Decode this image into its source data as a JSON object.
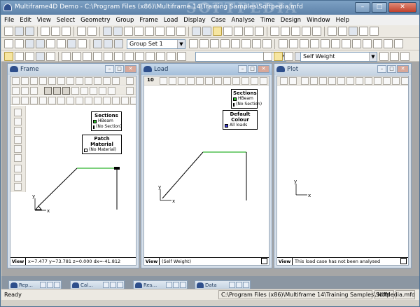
{
  "window": {
    "title": "Multiframe4D Demo - C:\\Program Files (x86)\\Multiframe 14\\Training Samples\\Softpedia.mfd",
    "watermark": "SOFTPEDIA",
    "min_label": "–",
    "max_label": "□",
    "close_label": "✕"
  },
  "menu": [
    "File",
    "Edit",
    "View",
    "Select",
    "Geometry",
    "Group",
    "Frame",
    "Load",
    "Display",
    "Case",
    "Analyse",
    "Time",
    "Design",
    "Window",
    "Help"
  ],
  "toolbar": {
    "group_combo": "Group Set 1",
    "load_case_combo": "Self Weight",
    "empty_combo": ""
  },
  "frame_window": {
    "title": "Frame",
    "sections_legend": {
      "heading": "Sections",
      "items": [
        {
          "label": "HBeam",
          "color": "#2db52d"
        },
        {
          "label": "(No Section)",
          "color": "#000000"
        }
      ]
    },
    "patch_legend": {
      "heading": "Patch Material",
      "items": [
        {
          "label": "(No Material)",
          "color": "#ffffff"
        }
      ]
    },
    "axis_y": "y",
    "axis_x": "x",
    "view_tab": "View",
    "status": "x=7.477 y=73.781 z=0.000 dx=-41.812"
  },
  "load_window": {
    "title": "Load",
    "toolbar_number": "10",
    "sections_legend": {
      "heading": "Sections",
      "items": [
        {
          "label": "HBeam",
          "color": "#2db52d"
        },
        {
          "label": "(No Section)",
          "color": "#000000"
        }
      ]
    },
    "colour_legend": {
      "heading": "Default Colour",
      "items": [
        {
          "label": "All loads",
          "color": "#3b3bd0"
        }
      ]
    },
    "axis_y": "y",
    "axis_x": "x",
    "view_tab": "View",
    "status": "(Self Weight)"
  },
  "plot_window": {
    "title": "Plot",
    "axis_y": "y",
    "axis_x": "x",
    "view_tab": "View",
    "status": "This load case has not been analysed"
  },
  "minimized": [
    {
      "label": "Rep..."
    },
    {
      "label": "Cal..."
    },
    {
      "label": "Res..."
    },
    {
      "label": "Data"
    }
  ],
  "statusbar": {
    "ready": "Ready",
    "path": "C:\\Program Files (x86)\\Multiframe 14\\Training Samples\\Softpedia.mfd",
    "num": "NUM"
  }
}
